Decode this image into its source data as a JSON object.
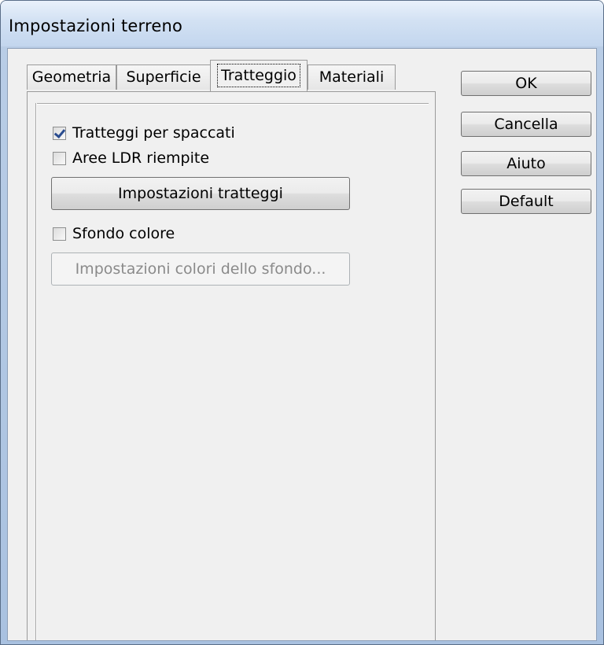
{
  "window": {
    "title": "Impostazioni terreno"
  },
  "tabs": [
    {
      "label": "Geometria",
      "active": false
    },
    {
      "label": "Superficie",
      "active": false
    },
    {
      "label": "Tratteggio",
      "active": true
    },
    {
      "label": "Materiali",
      "active": false
    }
  ],
  "tratteggio": {
    "hatch_sections": {
      "label": "Tratteggi per spaccati",
      "checked": true
    },
    "ldr_areas": {
      "label": "Aree LDR riempite",
      "checked": false
    },
    "hatch_settings_button": "Impostazioni tratteggi",
    "background_color": {
      "label": "Sfondo colore",
      "checked": false
    },
    "background_settings_button": "Impostazioni colori dello sfondo..."
  },
  "buttons": {
    "ok": "OK",
    "cancel": "Cancella",
    "help": "Aiuto",
    "default": "Default"
  }
}
